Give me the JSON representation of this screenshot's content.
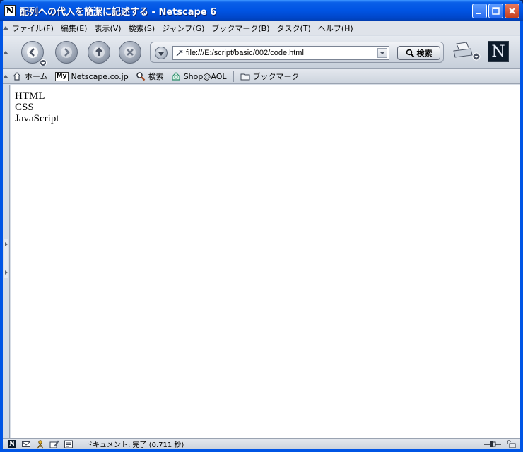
{
  "window": {
    "title": "配列への代入を簡潔に記述する - Netscape 6"
  },
  "menu": {
    "items": [
      {
        "label": "ファイル(F)"
      },
      {
        "label": "編集(E)"
      },
      {
        "label": "表示(V)"
      },
      {
        "label": "検索(S)"
      },
      {
        "label": "ジャンプ(G)"
      },
      {
        "label": "ブックマーク(B)"
      },
      {
        "label": "タスク(T)"
      },
      {
        "label": "ヘルプ(H)"
      }
    ]
  },
  "toolbar": {
    "url": "file:///E:/script/basic/002/code.html",
    "search_label": "検索",
    "logo_letter": "N"
  },
  "personal": {
    "items": [
      {
        "label": "ホーム",
        "icon": "home-icon"
      },
      {
        "label": "Netscape.co.jp",
        "icon": "my-icon",
        "badge": "My"
      },
      {
        "label": "検索",
        "icon": "search-icon"
      },
      {
        "label": "Shop@AOL",
        "icon": "shop-icon"
      },
      {
        "label": "ブックマーク",
        "icon": "folder-icon"
      }
    ]
  },
  "content": {
    "lines": [
      "HTML",
      "CSS",
      "JavaScript"
    ]
  },
  "status": {
    "text": "ドキュメント: 完了 (0.711 秒)"
  },
  "colors": {
    "titlebar": "#0054e3",
    "close_button": "#c5401f"
  }
}
